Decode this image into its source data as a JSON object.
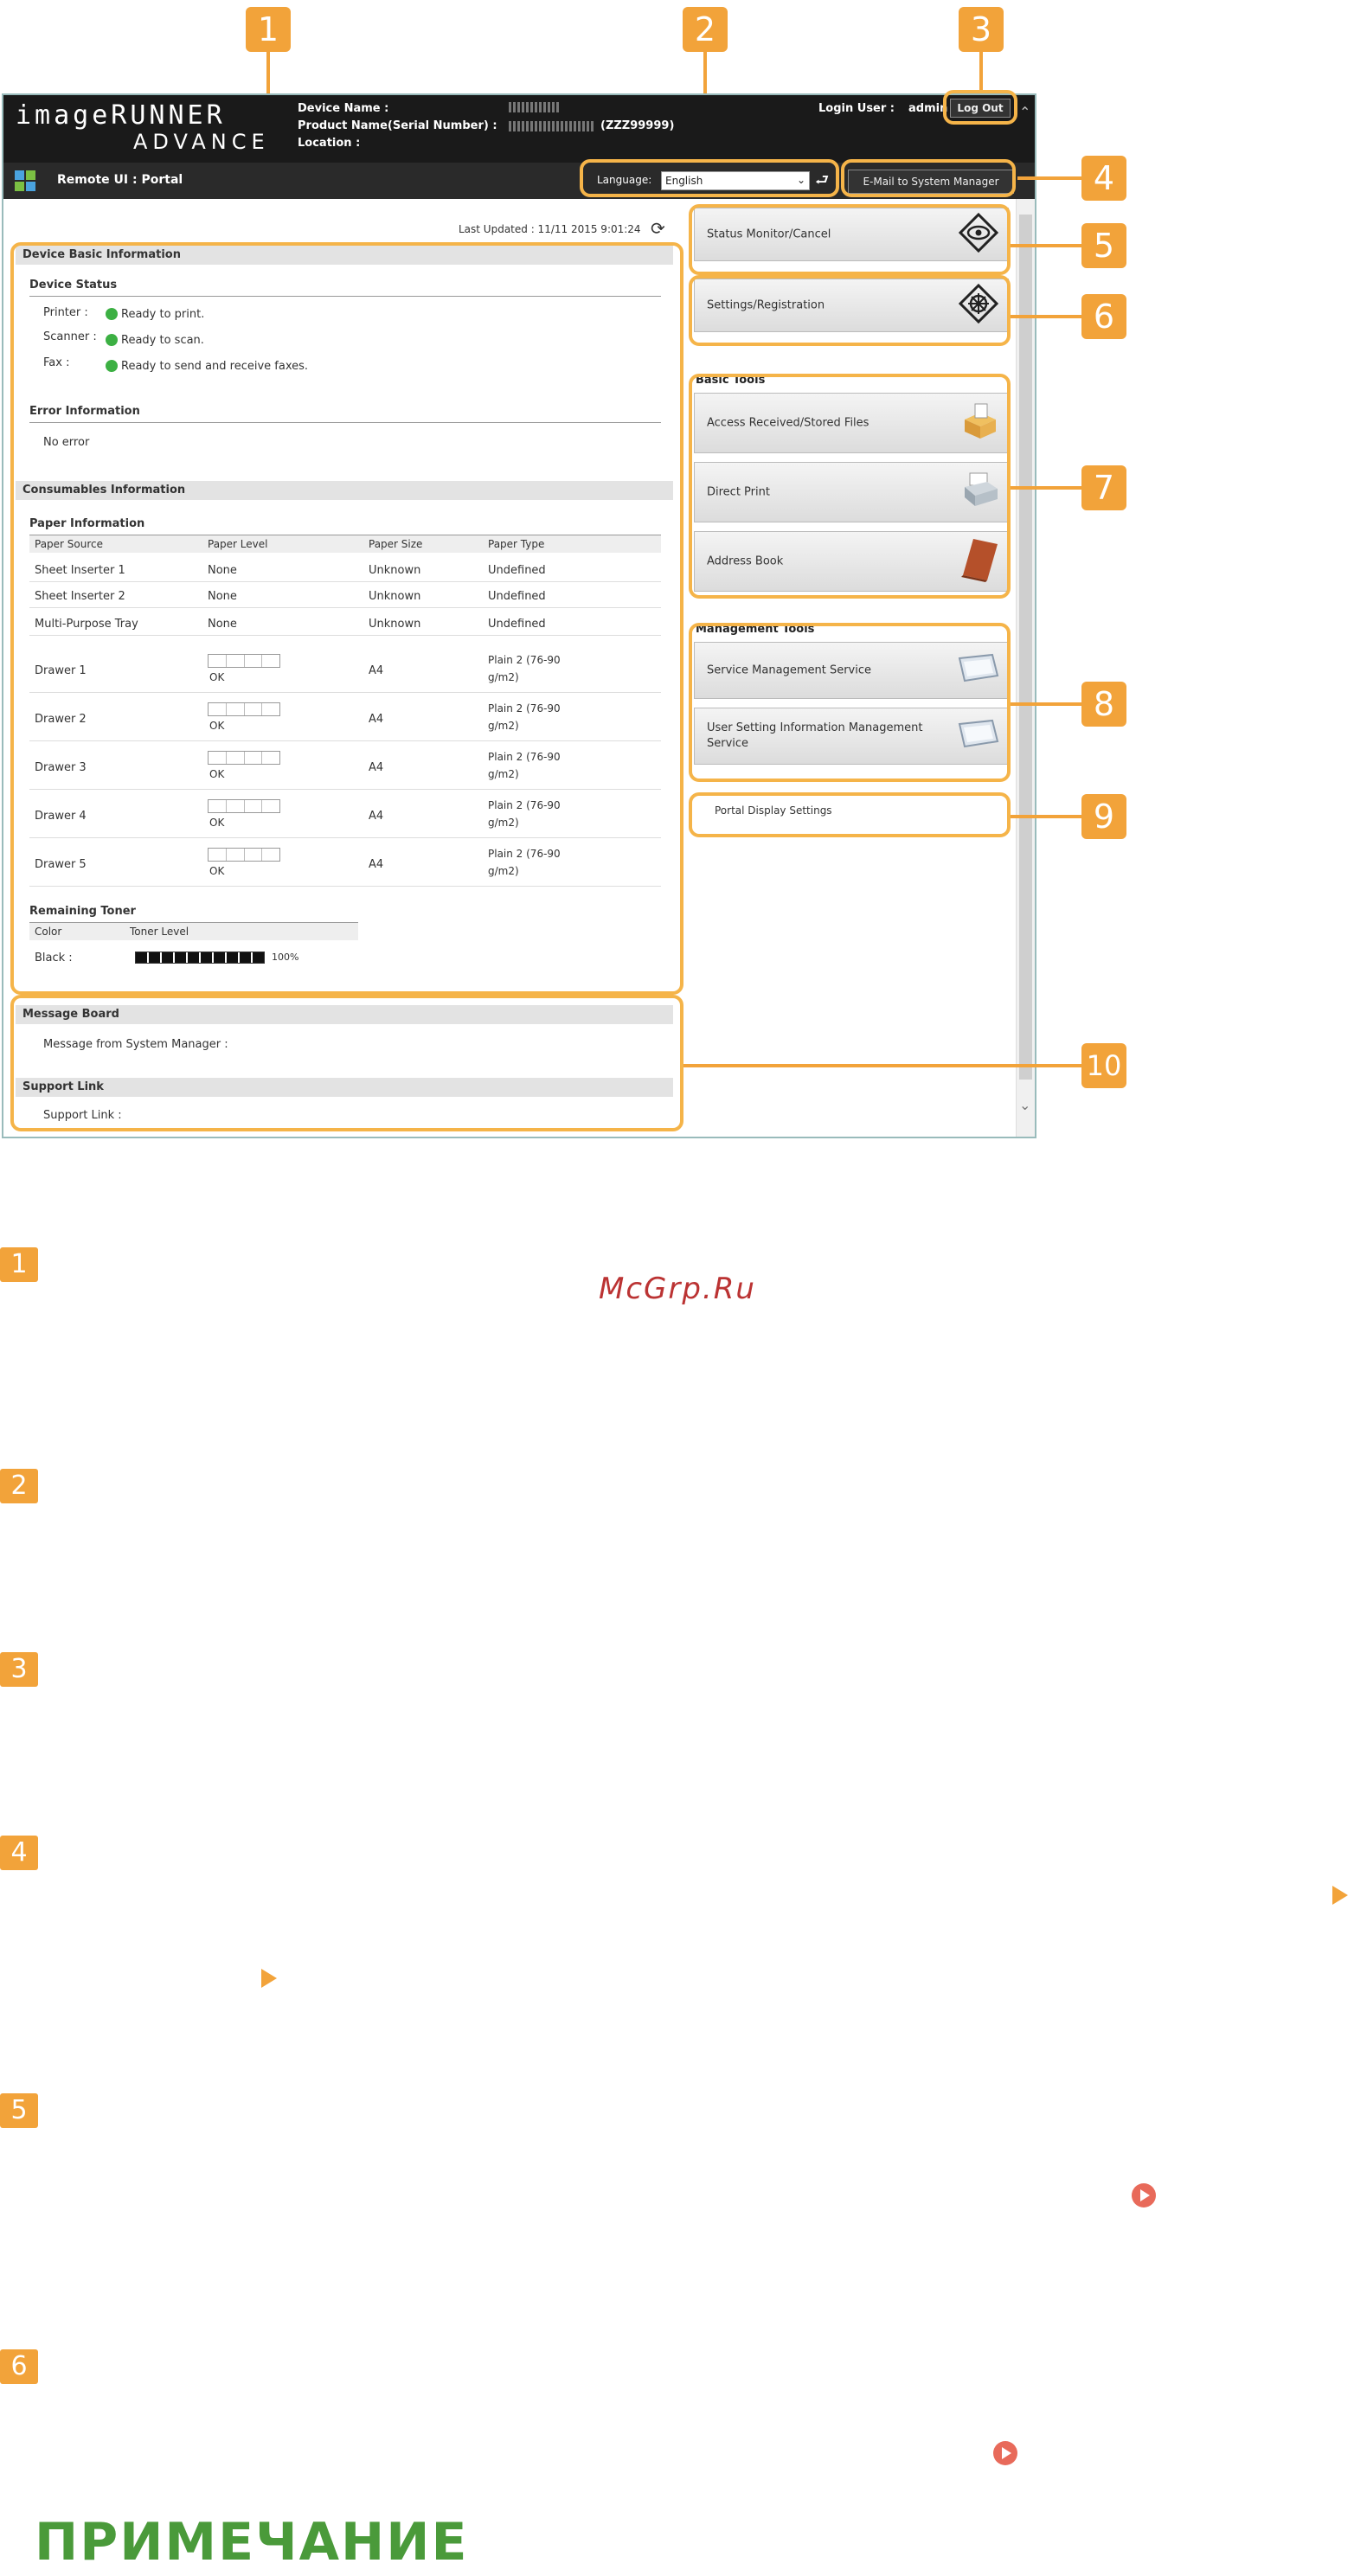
{
  "callouts": [
    "1",
    "2",
    "3",
    "4",
    "5",
    "6",
    "7",
    "8",
    "9",
    "10"
  ],
  "header": {
    "logo_line1": "imageRUNNER",
    "logo_line2": "ADVANCE",
    "device_name_label": "Device Name :",
    "product_name_label": "Product Name(Serial Number) :",
    "location_label": "Location :",
    "serial_suffix": "(ZZZ99999)",
    "login_user_label": "Login User :",
    "login_user_value": "admin",
    "logout_label": "Log Out",
    "app_title": "Remote UI : Portal",
    "language_label": "Language:",
    "language_value": "English",
    "email_button": "E-Mail to System Manager"
  },
  "last_updated": "Last Updated : 11/11 2015 9:01:24",
  "device_basic": {
    "title": "Device Basic Information",
    "status_title": "Device Status",
    "statuses": [
      {
        "label": "Printer :",
        "value": "Ready to print."
      },
      {
        "label": "Scanner :",
        "value": "Ready to scan."
      },
      {
        "label": "Fax :",
        "value": "Ready to send and receive faxes."
      }
    ],
    "error_title": "Error Information",
    "error_value": "No error"
  },
  "consumables": {
    "title": "Consumables Information",
    "paper_title": "Paper Information",
    "columns": [
      "Paper Source",
      "Paper Level",
      "Paper Size",
      "Paper Type"
    ],
    "simple_rows": [
      [
        "Sheet Inserter 1",
        "None",
        "Unknown",
        "Undefined"
      ],
      [
        "Sheet Inserter 2",
        "None",
        "Unknown",
        "Undefined"
      ],
      [
        "Multi-Purpose Tray",
        "None",
        "Unknown",
        "Undefined"
      ]
    ],
    "drawer_rows": [
      {
        "source": "Drawer 1",
        "level": "OK",
        "size": "A4",
        "type1": "Plain 2 (76-90",
        "type2": "g/m2)"
      },
      {
        "source": "Drawer 2",
        "level": "OK",
        "size": "A4",
        "type1": "Plain 2 (76-90",
        "type2": "g/m2)"
      },
      {
        "source": "Drawer 3",
        "level": "OK",
        "size": "A4",
        "type1": "Plain 2 (76-90",
        "type2": "g/m2)"
      },
      {
        "source": "Drawer 4",
        "level": "OK",
        "size": "A4",
        "type1": "Plain 2 (76-90",
        "type2": "g/m2)"
      },
      {
        "source": "Drawer 5",
        "level": "OK",
        "size": "A4",
        "type1": "Plain 2 (76-90",
        "type2": "g/m2)"
      }
    ],
    "toner_title": "Remaining Toner",
    "toner_columns": [
      "Color",
      "Toner Level"
    ],
    "toner_color": "Black :",
    "toner_level": "100%",
    "toner_fraction": 1.0
  },
  "message_board": {
    "title": "Message Board",
    "text": "Message from System Manager :"
  },
  "support_link": {
    "title": "Support Link",
    "text": "Support Link :"
  },
  "right": {
    "status_monitor": "Status Monitor/Cancel",
    "settings": "Settings/Registration",
    "basic_tools_title": "Basic Tools",
    "basic_tools": [
      "Access Received/Stored Files",
      "Direct Print",
      "Address Book"
    ],
    "management_title": "Management Tools",
    "management_tools": [
      "Service Management Service",
      "User Setting Information Management",
      "Service"
    ],
    "portal_display": "Portal Display Settings"
  },
  "doc": {
    "watermark": "McGrp.Ru",
    "note_heading": "ПРИМЕЧАНИЕ"
  },
  "colors": {
    "accent": "#f2a33a",
    "header": "#1a1a1a",
    "status_ok": "#3cb043",
    "note_green": "#4a9a3a"
  }
}
